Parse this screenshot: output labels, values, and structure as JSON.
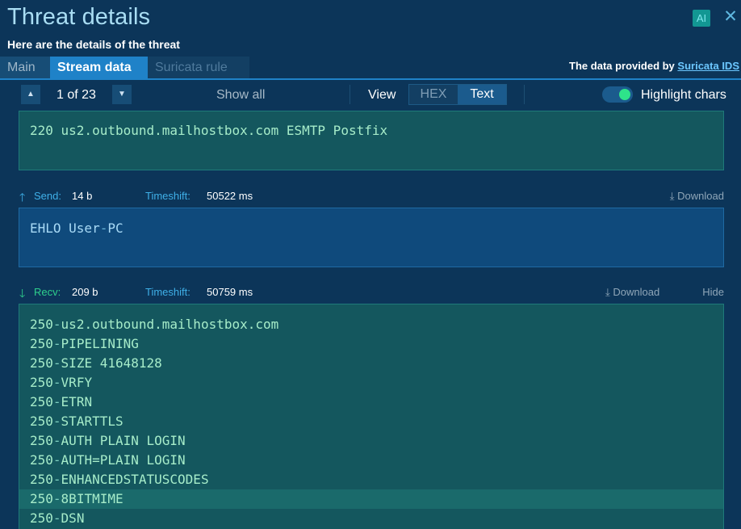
{
  "header": {
    "title": "Threat details",
    "subtitle": "Here are the details of the threat",
    "ai_label": "AI",
    "close_glyph": "✕"
  },
  "tabs": [
    {
      "label": "Main",
      "state": "normal"
    },
    {
      "label": "Stream data",
      "state": "active"
    },
    {
      "label": "Suricata rule",
      "state": "disabled"
    }
  ],
  "provider": {
    "prefix": "The data provided by ",
    "link": "Suricata IDS"
  },
  "toolbar": {
    "up_icon": "▲",
    "down_icon": "▼",
    "counter": "1 of 23",
    "show_all": "Show all",
    "view_label": "View",
    "view_options": [
      "HEX",
      "Text"
    ],
    "view_selected": "Text",
    "highlight_label": "Highlight chars",
    "highlight_on": true
  },
  "stream": {
    "first_recv": {
      "lines": [
        "220 us2.outbound.mailhostbox.com ESMTP Postfix"
      ]
    },
    "send": {
      "direction": "Send:",
      "size": "14 b",
      "timeshift_label": "Timeshift:",
      "timeshift": "50522 ms",
      "download": "Download",
      "lines": [
        "EHLO User-PC"
      ]
    },
    "recv": {
      "direction": "Recv:",
      "size": "209 b",
      "timeshift_label": "Timeshift:",
      "timeshift": "50759 ms",
      "download": "Download",
      "hide": "Hide",
      "lines": [
        "250-us2.outbound.mailhostbox.com",
        "250-PIPELINING",
        "250-SIZE 41648128",
        "250-VRFY",
        "250-ETRN",
        "250-STARTTLS",
        "250-AUTH PLAIN LOGIN",
        "250-AUTH=PLAIN LOGIN",
        "250-ENHANCEDSTATUSCODES",
        "250-8BITMIME",
        "250-DSN"
      ],
      "highlighted_line": "250-8BITMIME"
    }
  },
  "colors": {
    "background": "#0c3559",
    "accent": "#1f82c8",
    "recv_block": "#14575e",
    "send_block": "#0f4a7c",
    "toggle_on": "#2ee38a"
  }
}
